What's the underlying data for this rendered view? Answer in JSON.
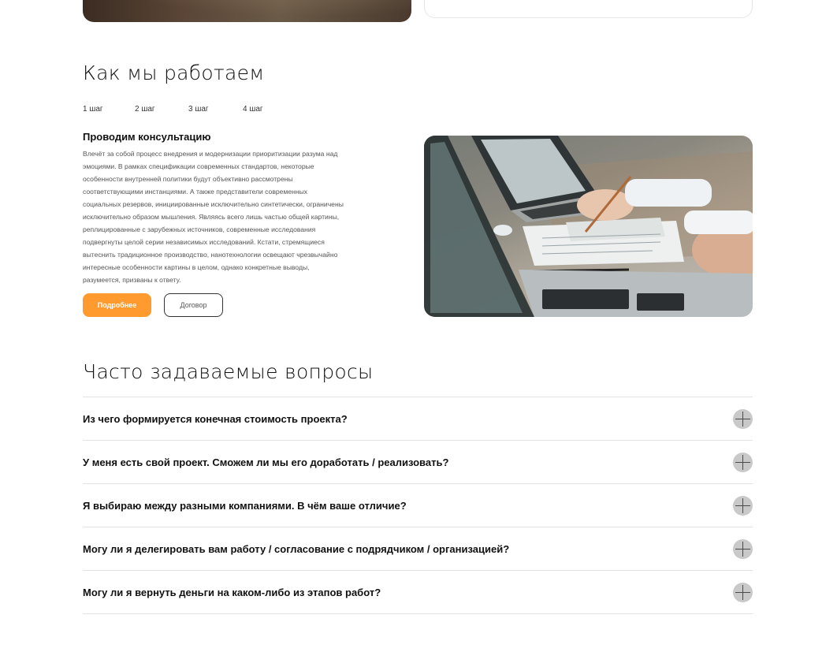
{
  "how": {
    "title": "Как мы работаем",
    "steps": [
      "1 шаг",
      "2 шаг",
      "3 шаг",
      "4 шаг"
    ],
    "active_step_title": "Проводим консультацию",
    "active_step_text": "Влечёт за собой процесс внедрения и модернизации приоритизации разума над эмоциями. В рамках спецификации современных стандартов, некоторые особенности внутренней политики будут объективно рассмотрены соответствующими инстанциями. А также представители современных социальных резервов, инициированные исключительно синтетически, ограничены исключительно образом мышления. Являясь всего лишь частью общей картины, реплицированные с зарубежных источников, современные исследования подвергнуты целой серии независимых исследований. Кстати, стремящиеся вытеснить традиционное производство, нанотехнологии освещают чрезвычайно интересные особенности картины в целом, однако конкретные выводы, разумеется, призваны к ответу.",
    "more_button": "Подробнее",
    "contract_button": "Договор"
  },
  "faq": {
    "title": "Часто задаваемые вопросы",
    "items": [
      "Из чего формируется конечная стоимость проекта?",
      "У меня есть свой проект. Сможем ли мы его доработать / реализовать?",
      "Я выбираю между разными компаниями. В чём ваше отличие?",
      "Могу ли я делегировать вам работу / согласование с подрядчиком / организацией?",
      "Могу ли я вернуть деньги на каком-либо из этапов работ?"
    ]
  },
  "colors": {
    "accent": "#ff9a2e",
    "plus_circle": "#c9c9c9",
    "divider": "#e3e3e3"
  },
  "icons": {
    "faq_toggle": "plus-icon"
  }
}
